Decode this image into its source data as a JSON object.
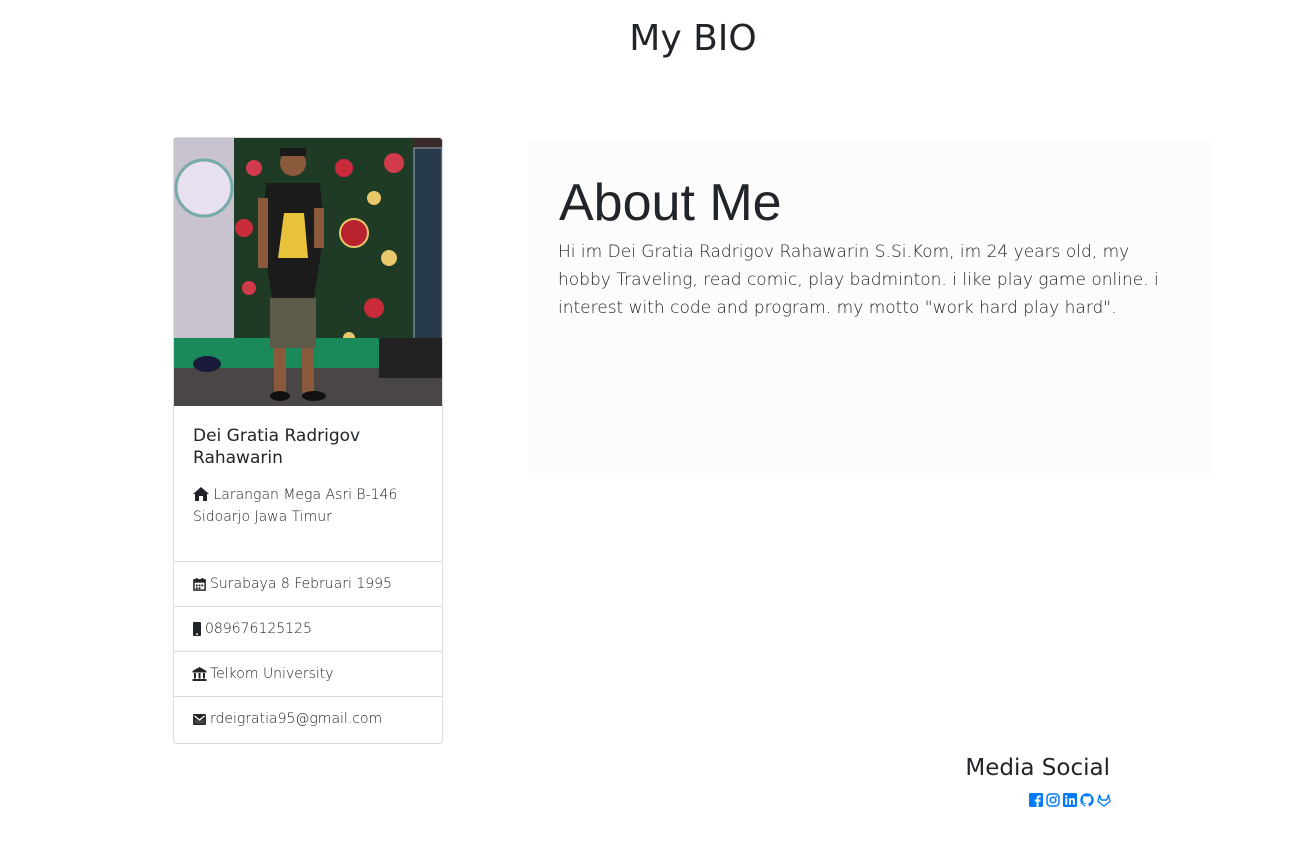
{
  "page": {
    "title": "My BIO"
  },
  "profile": {
    "name": "Dei Gratia Radrigov Rahawarin",
    "address_line1": "Larangan Mega Asri B-146",
    "address_line2": "Sidoarjo Jawa Timur",
    "details": [
      {
        "icon": "calendar-icon",
        "text": "Surabaya 8 Februari 1995"
      },
      {
        "icon": "mobile-phone-icon",
        "text": "089676125125"
      },
      {
        "icon": "university-icon",
        "text": "Telkom University"
      },
      {
        "icon": "envelope-icon",
        "text": "rdeigratia95@gmail.com"
      }
    ]
  },
  "about": {
    "title": "About Me",
    "text": "Hi im Dei Gratia Radrigov Rahawarin S.Si.Kom, im 24 years old, my hobby Traveling, read comic, play badminton. i like play game online. i interest with code and program. my motto \"work hard play hard\"."
  },
  "social": {
    "title": "Media Social",
    "links": [
      "facebook-icon",
      "instagram-icon",
      "linkedin-icon",
      "github-icon",
      "gitlab-icon"
    ],
    "accent": "#007bff"
  }
}
